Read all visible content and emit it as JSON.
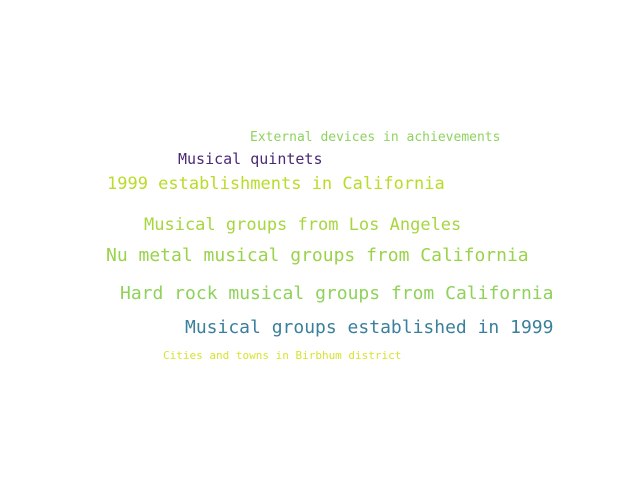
{
  "words": [
    {
      "text": "External devices in achievements",
      "color": "#8fd35f"
    },
    {
      "text": "Musical quintets",
      "color": "#4a2a74"
    },
    {
      "text": "1999 establishments in California",
      "color": "#b8dc2a"
    },
    {
      "text": "Musical groups from Los Angeles",
      "color": "#a7d63f"
    },
    {
      "text": "Nu metal musical groups from California",
      "color": "#9ad34a"
    },
    {
      "text": "Hard rock musical groups from California",
      "color": "#8ed25a"
    },
    {
      "text": "Musical groups established in 1999",
      "color": "#3a7f9c"
    },
    {
      "text": "Cities and towns in Birbhum district",
      "color": "#d8e330"
    }
  ]
}
